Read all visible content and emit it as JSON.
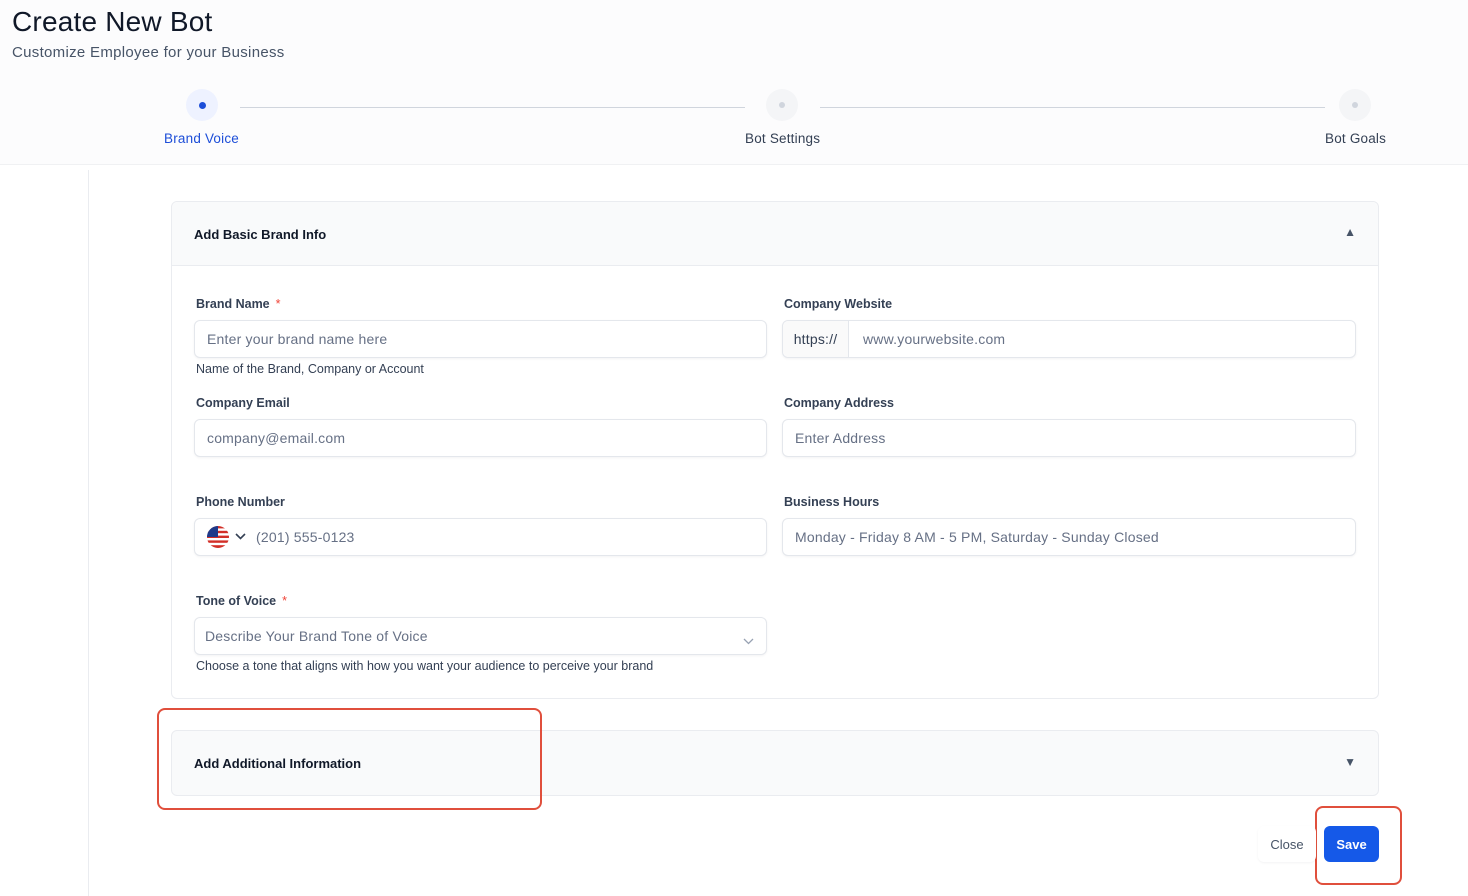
{
  "page": {
    "title": "Create New Bot",
    "subtitle": "Customize Employee for your Business"
  },
  "stepper": {
    "steps": [
      {
        "label": "Brand Voice",
        "state": "active"
      },
      {
        "label": "Bot Settings",
        "state": "inactive"
      },
      {
        "label": "Bot Goals",
        "state": "inactive"
      }
    ]
  },
  "basic_info": {
    "title": "Add Basic Brand Info",
    "caret": "▲",
    "brand_name": {
      "label": "Brand Name",
      "required_mark": "*",
      "placeholder": "Enter your brand name here",
      "help": "Name of the Brand, Company or Account"
    },
    "company_website": {
      "label": "Company Website",
      "prefix": "https://",
      "placeholder": "www.yourwebsite.com"
    },
    "company_email": {
      "label": "Company Email",
      "placeholder": "company@email.com"
    },
    "company_address": {
      "label": "Company Address",
      "placeholder": "Enter Address"
    },
    "phone_number": {
      "label": "Phone Number",
      "country": "US",
      "placeholder": "(201) 555-0123"
    },
    "business_hours": {
      "label": "Business Hours",
      "placeholder": "Monday - Friday 8 AM - 5 PM, Saturday - Sunday Closed"
    },
    "tone_of_voice": {
      "label": "Tone of Voice",
      "required_mark": "*",
      "placeholder": "Describe Your Brand Tone of Voice",
      "help": "Choose a tone that aligns with how you want your audience to perceive your brand"
    }
  },
  "additional_info": {
    "title": "Add Additional Information",
    "caret": "▼"
  },
  "actions": {
    "close_label": "Close",
    "save_label": "Save"
  },
  "colors": {
    "accent": "#1559e8",
    "active_step": "#1d4ed8",
    "required": "#f04438",
    "highlight": "#e04f3c"
  }
}
